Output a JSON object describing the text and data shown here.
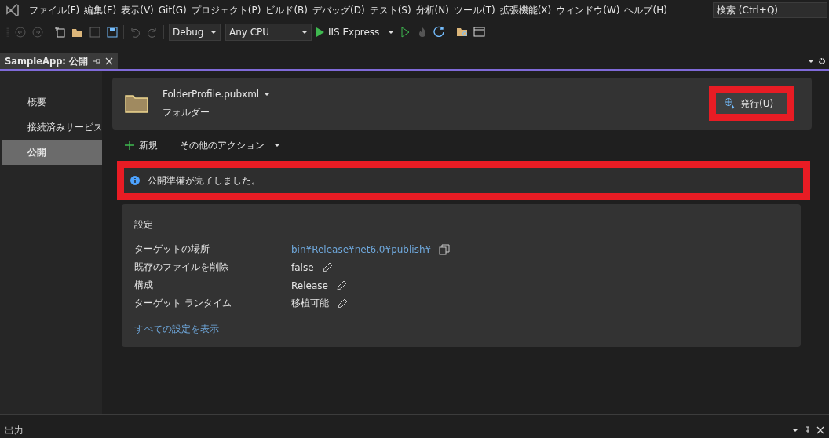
{
  "menu": [
    {
      "label": "ファイル(F)"
    },
    {
      "label": "編集(E)"
    },
    {
      "label": "表示(V)"
    },
    {
      "label": "Git(G)"
    },
    {
      "label": "プロジェクト(P)"
    },
    {
      "label": "ビルド(B)"
    },
    {
      "label": "デバッグ(D)"
    },
    {
      "label": "テスト(S)"
    },
    {
      "label": "分析(N)"
    },
    {
      "label": "ツール(T)"
    },
    {
      "label": "拡張機能(X)"
    },
    {
      "label": "ウィンドウ(W)"
    },
    {
      "label": "ヘルプ(H)"
    }
  ],
  "search": {
    "placeholder": "検索 (Ctrl+Q)"
  },
  "toolbar": {
    "configuration": "Debug",
    "platform": "Any CPU",
    "run_target": "IIS Express"
  },
  "tabs": [
    {
      "label": "SampleApp: 公開",
      "selected": true
    }
  ],
  "sidebar": {
    "items": [
      {
        "label": "概要",
        "selected": false
      },
      {
        "label": "接続済みサービス",
        "selected": false
      },
      {
        "label": "公開",
        "selected": true
      }
    ]
  },
  "profile": {
    "name": "FolderProfile.pubxml",
    "type": "フォルダー"
  },
  "publish_button": {
    "label": "発行(U)",
    "highlighted": true
  },
  "actions": {
    "new": "新規",
    "more": "その他のアクション"
  },
  "info_bar": {
    "text": "公開準備が完了しました。",
    "highlighted": true
  },
  "settings": {
    "title": "設定",
    "rows": [
      {
        "label": "ターゲットの場所",
        "value": "bin¥Release¥net6.0¥publish¥",
        "kind": "link"
      },
      {
        "label": "既存のファイルを削除",
        "value": "false",
        "kind": "text"
      },
      {
        "label": "構成",
        "value": "Release",
        "kind": "text"
      },
      {
        "label": "ターゲット ランタイム",
        "value": "移植可能",
        "kind": "text"
      }
    ],
    "show_all_link": "すべての設定を表示"
  },
  "output_panel": {
    "title": "出力"
  }
}
